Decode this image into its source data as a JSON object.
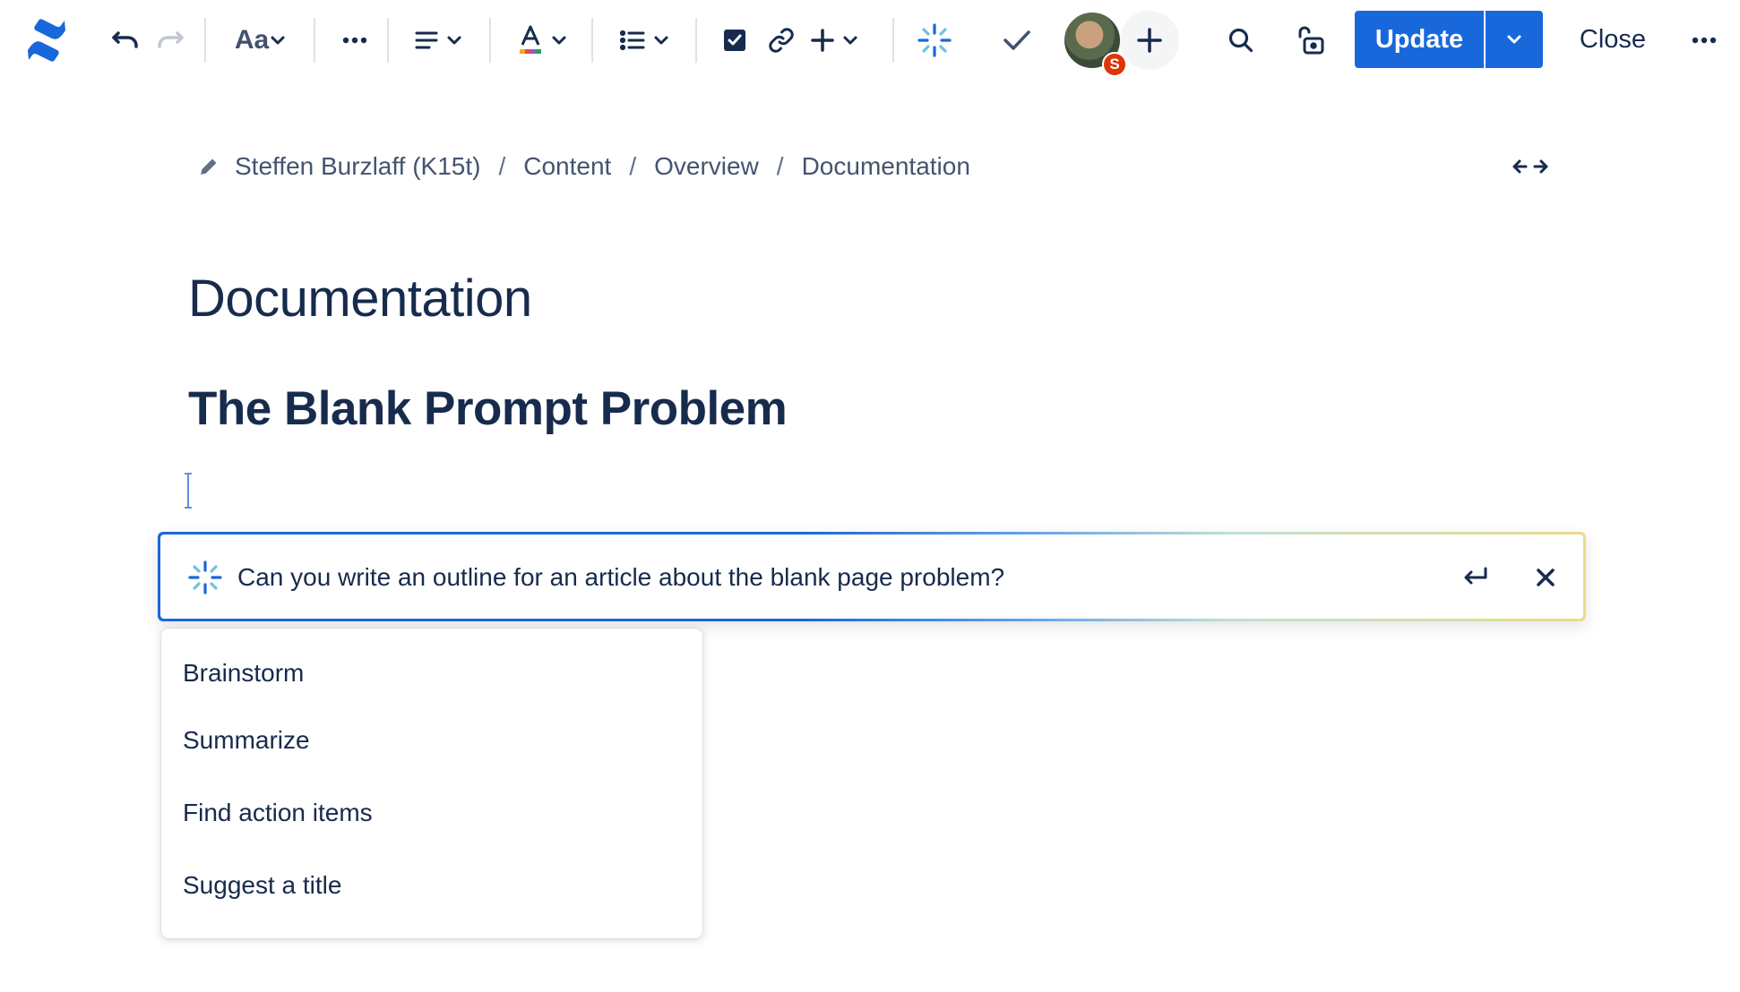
{
  "toolbar": {
    "text_style_label": "Aa",
    "update_label": "Update",
    "close_label": "Close",
    "collaborator_badge": "S",
    "icons": {
      "logo": "confluence-logo-icon",
      "undo": "undo-icon",
      "redo": "redo-icon",
      "more": "more-horizontal-icon",
      "align": "text-align-icon",
      "color": "text-color-icon",
      "list": "bullet-list-icon",
      "task": "checkbox-icon",
      "link": "link-icon",
      "insert": "plus-icon",
      "ai": "atlassian-intelligence-icon",
      "check": "check-icon",
      "search": "search-icon",
      "lock": "unlock-icon"
    }
  },
  "breadcrumb": {
    "items": [
      "Steffen Burzlaff (K15t)",
      "Content",
      "Overview",
      "Documentation"
    ],
    "separator": "/"
  },
  "page": {
    "title": "Documentation",
    "heading": "The Blank Prompt Problem"
  },
  "ai_prompt": {
    "text": "Can you write an outline for an article about the blank page problem?"
  },
  "suggestions": [
    "Brainstorm",
    "Summarize",
    "Find action items",
    "Suggest a title"
  ],
  "colors": {
    "primary": "#1868db",
    "text": "#172b4d",
    "subtle": "#44546f",
    "badge": "#de350b"
  }
}
